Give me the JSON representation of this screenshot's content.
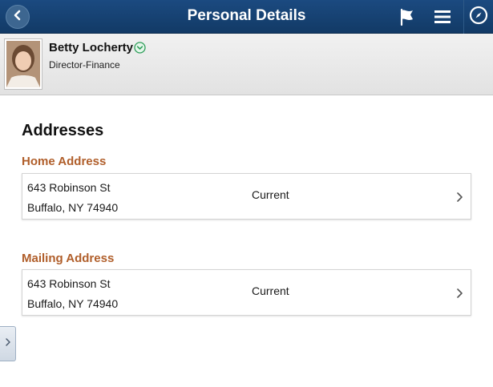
{
  "header": {
    "title": "Personal Details",
    "bg_color": "#1b4a80",
    "back_icon": "chevron-left-icon",
    "flag_icon": "flag-icon",
    "menu_icon": "hamburger-menu-icon",
    "nav_icon": "compass-icon"
  },
  "profile": {
    "name": "Betty Locherty",
    "title": "Director-Finance",
    "related_icon": "chevron-down-circle-icon"
  },
  "main": {
    "section_title": "Addresses",
    "label_color": "#b05e2a",
    "addresses": [
      {
        "label": "Home Address",
        "line1": "643 Robinson St",
        "line2": "Buffalo, NY 74940",
        "status": "Current"
      },
      {
        "label": "Mailing Address",
        "line1": "643 Robinson St",
        "line2": "Buffalo, NY 74940",
        "status": "Current"
      }
    ]
  },
  "side_tab": {
    "icon": "chevron-right-icon"
  }
}
